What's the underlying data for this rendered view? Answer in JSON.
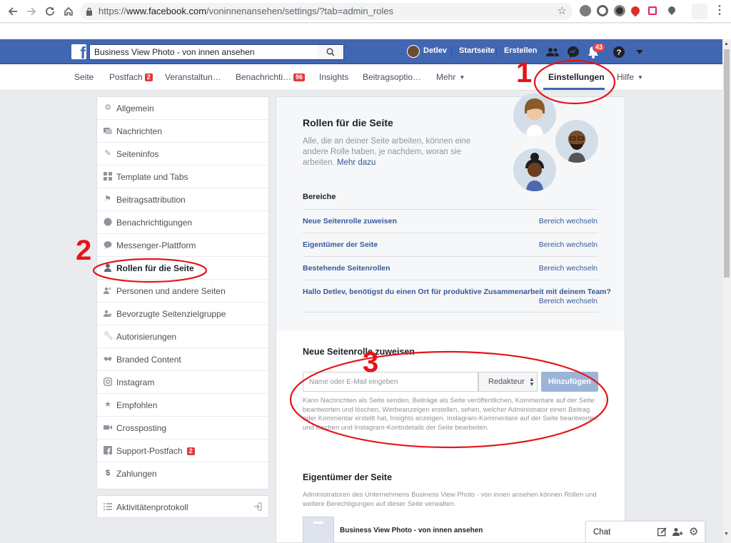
{
  "browser": {
    "url_prefix": "https://",
    "url_host": "www.facebook.com",
    "url_path": "/voninnenansehen/settings/?tab=admin_roles"
  },
  "topbar": {
    "search_value": "Business View Photo - von innen ansehen",
    "user_name": "Detlev",
    "home_label": "Startseite",
    "create_label": "Erstellen",
    "notification_count": "43"
  },
  "tabs": [
    {
      "label": "Seite"
    },
    {
      "label": "Postfach",
      "badge": "2"
    },
    {
      "label": "Veranstaltun…"
    },
    {
      "label": "Benachrichti…",
      "badge": "96"
    },
    {
      "label": "Insights"
    },
    {
      "label": "Beitragsoptio…"
    },
    {
      "label": "Mehr"
    },
    {
      "label": "Einstellungen"
    },
    {
      "label": "Hilfe"
    }
  ],
  "sidebar": {
    "items": [
      {
        "label": "Allgemein",
        "icon": "gear-icon"
      },
      {
        "label": "Nachrichten",
        "icon": "messages-icon"
      },
      {
        "label": "Seiteninfos",
        "icon": "pencil-icon"
      },
      {
        "label": "Template und Tabs",
        "icon": "grid-icon"
      },
      {
        "label": "Beitragsattribution",
        "icon": "flag-icon"
      },
      {
        "label": "Benachrichtigungen",
        "icon": "globe-icon"
      },
      {
        "label": "Messenger-Plattform",
        "icon": "chat-bubble-icon"
      },
      {
        "label": "Rollen für die Seite",
        "icon": "person-icon"
      },
      {
        "label": "Personen und andere Seiten",
        "icon": "people-icon"
      },
      {
        "label": "Bevorzugte Seitenzielgruppe",
        "icon": "audience-icon"
      },
      {
        "label": "Autorisierungen",
        "icon": "wrench-icon"
      },
      {
        "label": "Branded Content",
        "icon": "handshake-icon"
      },
      {
        "label": "Instagram",
        "icon": "instagram-icon"
      },
      {
        "label": "Empfohlen",
        "icon": "star-icon"
      },
      {
        "label": "Crossposting",
        "icon": "video-icon"
      },
      {
        "label": "Support-Postfach",
        "icon": "facebook-icon",
        "badge": "2"
      },
      {
        "label": "Zahlungen",
        "icon": "dollar-icon"
      }
    ],
    "activity_log": "Aktivitätenprotokoll"
  },
  "roles": {
    "title": "Rollen für die Seite",
    "description": "Alle, die an deiner Seite arbeiten, können eine andere Rolle haben, je nachdem, woran sie arbeiten.",
    "more_link": "Mehr dazu",
    "sections_heading": "Bereiche",
    "sections": [
      {
        "label": "Neue Seitenrolle zuweisen",
        "action": "Bereich wechseln"
      },
      {
        "label": "Eigentümer der Seite",
        "action": "Bereich wechseln"
      },
      {
        "label": "Bestehende Seitenrollen",
        "action": "Bereich wechseln"
      }
    ],
    "team_prompt": "Hallo Detlev, benötigst du einen Ort für produktive Zusammenarbeit mit deinem Team?",
    "team_action": "Bereich wechseln"
  },
  "assign": {
    "title": "Neue Seitenrolle zuweisen",
    "input_placeholder": "Name oder E-Mail eingeben",
    "role_value": "Redakteur",
    "add_label": "Hinzufügen",
    "role_description": "Kann Nachrichten als Seite senden, Beiträge als Seite veröffentlichen, Kommentare auf der Seite beantworten und löschen, Werbeanzeigen erstellen, sehen, welcher Administrator einen Beitrag oder Kommentar erstellt hat, Insights anzeigen, Instagram-Kommentare auf der Seite beantworten und löschen und Instagram-Kontodetails der Seite bearbeiten."
  },
  "owner": {
    "title": "Eigentümer der Seite",
    "description": "Administratoren des Unternehmens Business View Photo - von innen ansehen können Rollen und weitere Berechtigungen auf dieser Seite verwalten.",
    "business_name": "Business View Photo - von innen ansehen"
  },
  "chat": {
    "label": "Chat"
  },
  "annotations": [
    "1",
    "2",
    "3"
  ],
  "colors": {
    "fb_blue": "#4267b2",
    "annotation_red": "#e4141b",
    "link": "#365899"
  }
}
